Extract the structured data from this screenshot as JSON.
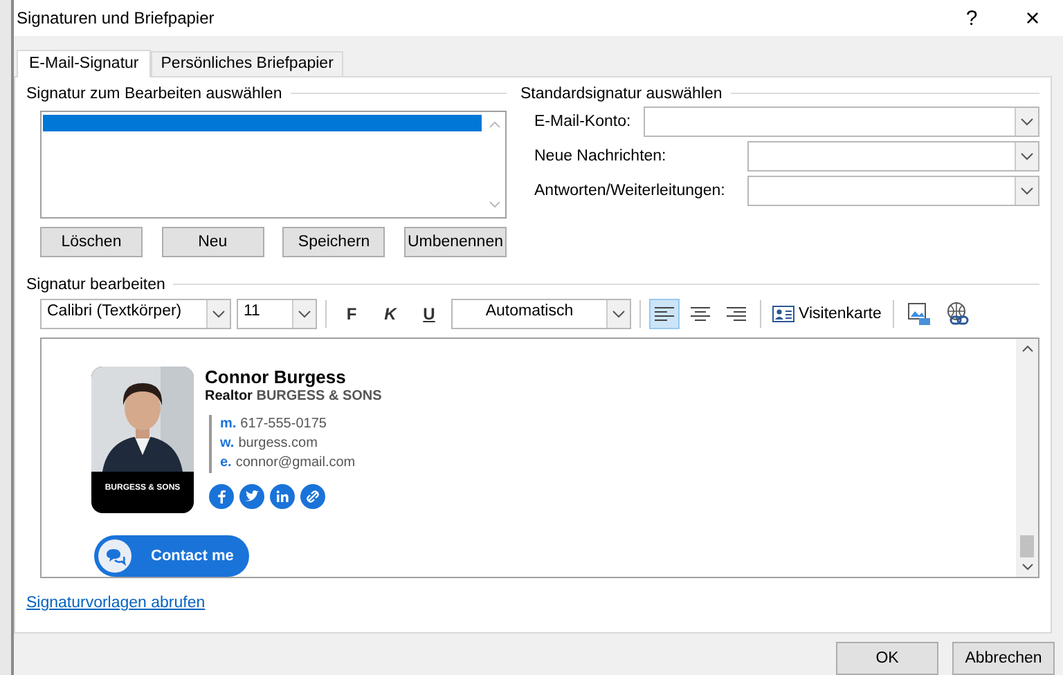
{
  "window": {
    "title": "Signaturen und Briefpapier",
    "help": "?",
    "close": "×"
  },
  "tabs": [
    {
      "label": "E-Mail-Signatur",
      "selected": true
    },
    {
      "label": "Persönliches Briefpapier",
      "selected": false
    }
  ],
  "select_group": {
    "heading": "Signatur zum Bearbeiten auswählen",
    "signatures": [
      {
        "selected": true
      }
    ],
    "buttons": [
      "Löschen",
      "Neu",
      "Speichern",
      "Umbenennen"
    ]
  },
  "default_group": {
    "heading": "Standardsignatur auswählen",
    "fields": [
      {
        "label": "E-Mail-Konto:"
      },
      {
        "label": "Neue Nachrichten:"
      },
      {
        "label": "Antworten/Weiterleitungen:"
      }
    ]
  },
  "editor": {
    "heading": "Signatur bearbeiten",
    "font": "Calibri (Textkörper)",
    "size": "11",
    "format_buttons": [
      {
        "label": "F",
        "kind": "bold"
      },
      {
        "label": "K",
        "kind": "italic"
      },
      {
        "label": "U",
        "kind": "underline"
      }
    ],
    "font_color_choice": "Automatisch",
    "alignments": [
      {
        "kind": "left",
        "selected": true
      },
      {
        "kind": "center",
        "selected": false
      },
      {
        "kind": "right",
        "selected": false
      }
    ],
    "business_card": "Visitenkarte",
    "signature": {
      "photo_caption": "BURGESS & SONS",
      "name": "Connor Burgess",
      "role": "**Realtor** BURGESS & SONS",
      "contacts": [
        {
          "prefix": "m.",
          "value": "617-555-0175"
        },
        {
          "prefix": "w.",
          "value": "burgess.com"
        },
        {
          "prefix": "e.",
          "value": "connor@gmail.com"
        }
      ],
      "socials": [
        {
          "kind": "facebook"
        },
        {
          "kind": "twitter"
        },
        {
          "kind": "linkedin"
        },
        {
          "kind": "web"
        }
      ],
      "contact_button": "Contact me"
    }
  },
  "template_link": "Signaturvorlagen abrufen",
  "buttons": [
    "OK",
    "Abbrechen"
  ]
}
